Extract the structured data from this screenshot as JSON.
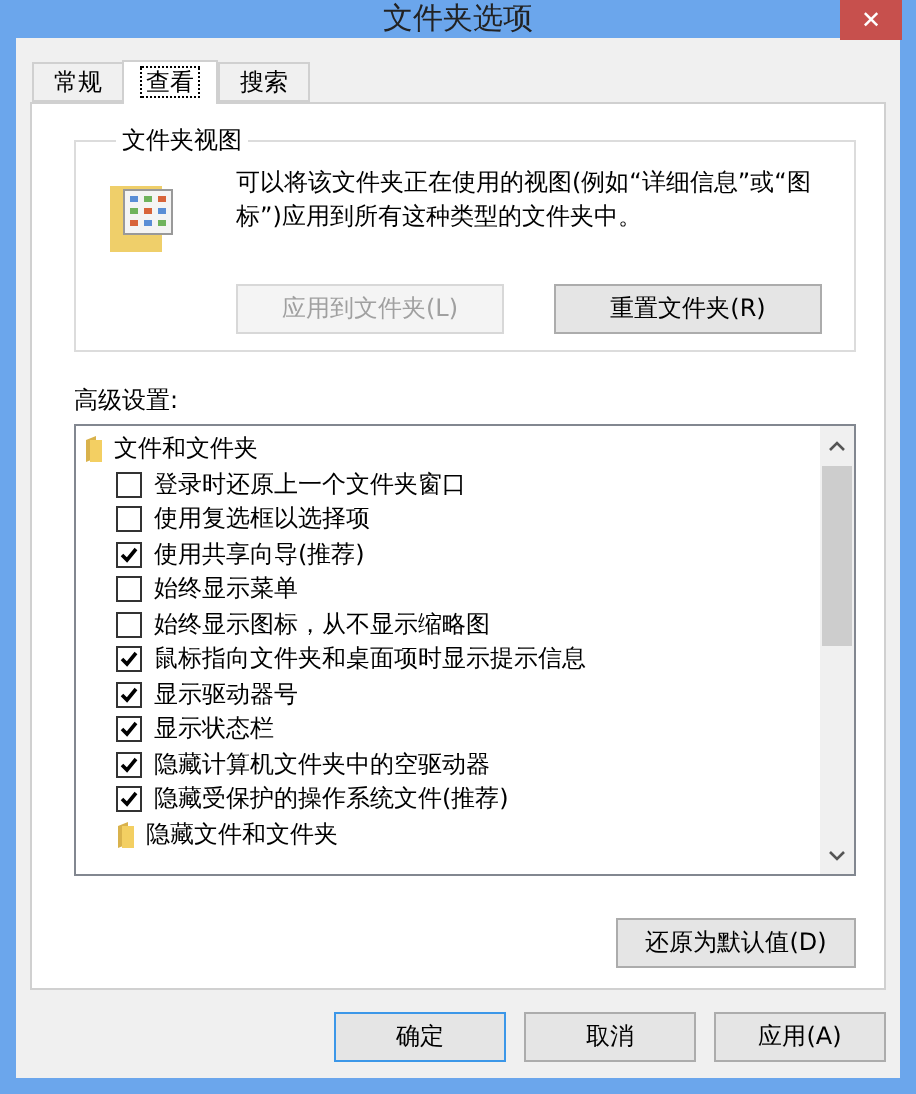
{
  "window": {
    "title": "文件夹选项",
    "close": "✕"
  },
  "tabs": [
    {
      "label": "常规",
      "selected": false
    },
    {
      "label": "查看",
      "selected": true
    },
    {
      "label": "搜索",
      "selected": false
    }
  ],
  "folder_views": {
    "title": "文件夹视图",
    "description": "可以将该文件夹正在使用的视图(例如“详细信息”或“图标”)应用到所有这种类型的文件夹中。",
    "buttons": [
      {
        "label": "应用到文件夹(L)",
        "disabled": true
      },
      {
        "label": "重置文件夹(R)",
        "disabled": false
      }
    ]
  },
  "advanced": {
    "label": "高级设置:",
    "items": [
      {
        "kind": "folder",
        "label": "文件和文件夹",
        "children": [
          {
            "kind": "checkbox",
            "label": "登录时还原上一个文件夹窗口",
            "checked": false
          },
          {
            "kind": "checkbox",
            "label": "使用复选框以选择项",
            "checked": false
          },
          {
            "kind": "checkbox",
            "label": "使用共享向导(推荐)",
            "checked": true
          },
          {
            "kind": "checkbox",
            "label": "始终显示菜单",
            "checked": false
          },
          {
            "kind": "checkbox",
            "label": "始终显示图标，从不显示缩略图",
            "checked": false
          },
          {
            "kind": "checkbox",
            "label": "鼠标指向文件夹和桌面项时显示提示信息",
            "checked": true
          },
          {
            "kind": "checkbox",
            "label": "显示驱动器号",
            "checked": true
          },
          {
            "kind": "checkbox",
            "label": "显示状态栏",
            "checked": true
          },
          {
            "kind": "checkbox",
            "label": "隐藏计算机文件夹中的空驱动器",
            "checked": true
          },
          {
            "kind": "checkbox",
            "label": "隐藏受保护的操作系统文件(推荐)",
            "checked": true
          },
          {
            "kind": "folder",
            "label": "隐藏文件和文件夹"
          }
        ]
      }
    ],
    "restore_button": "还原为默认值(D)"
  },
  "footer_buttons": [
    {
      "label": "确定",
      "default": true
    },
    {
      "label": "取消",
      "default": false
    },
    {
      "label": "应用(A)",
      "default": false
    }
  ]
}
